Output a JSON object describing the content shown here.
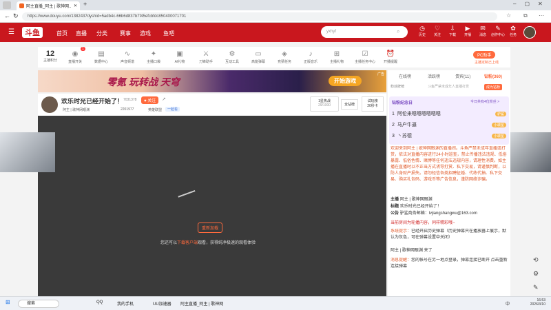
{
  "browser": {
    "tab_title": "阿主直播_阿主 | 歌神网...",
    "url": "https://www.douyu.com/1382437dyshid=5adb4c-66b6d837b7f45efcbfdc850400071701"
  },
  "header": {
    "logo": "斗鱼",
    "nav": [
      "首页",
      "直播",
      "分类",
      "赛事",
      "游戏",
      "鱼吧"
    ],
    "search_placeholder": "yxhyf",
    "icons": [
      {
        "name": "history",
        "label": "历史",
        "glyph": "◷"
      },
      {
        "name": "follow",
        "label": "关注",
        "glyph": "♡"
      },
      {
        "name": "download",
        "label": "下载",
        "glyph": "⇩"
      },
      {
        "name": "broadcast",
        "label": "开播",
        "glyph": "▶"
      },
      {
        "name": "message",
        "label": "消息",
        "glyph": "✉"
      },
      {
        "name": "creator",
        "label": "创作中心",
        "glyph": "✎"
      },
      {
        "name": "task",
        "label": "任务",
        "glyph": "✿"
      }
    ]
  },
  "toolbar": {
    "score_value": "12",
    "score_label": "主播积分",
    "badge_count": "1",
    "items": [
      {
        "name": "live-switch",
        "label": "直播开关",
        "glyph": "◉"
      },
      {
        "name": "data",
        "label": "数据中心",
        "glyph": "▤"
      },
      {
        "name": "voice",
        "label": "声音频谱",
        "glyph": "∿"
      },
      {
        "name": "mouth",
        "label": "主播口袋",
        "glyph": "✦"
      },
      {
        "name": "ai",
        "label": "AI礼物",
        "glyph": "▣"
      },
      {
        "name": "bladefight",
        "label": "刀锋助手",
        "glyph": "⚔"
      },
      {
        "name": "tools",
        "label": "互动工具",
        "glyph": "⚙"
      },
      {
        "name": "barrage",
        "label": "高能弹幕",
        "glyph": "▭"
      },
      {
        "name": "guess",
        "label": "竞猜任务",
        "glyph": "◈"
      },
      {
        "name": "music",
        "label": "正版音乐",
        "glyph": "♪"
      },
      {
        "name": "gift",
        "label": "主播礼物",
        "glyph": "⊞"
      },
      {
        "name": "task",
        "label": "主播任务中心",
        "glyph": "☑"
      },
      {
        "name": "alarm",
        "label": "开播提醒",
        "glyph": "⏰"
      }
    ],
    "pc_label": "PC助手",
    "pc_link": "主播定制己上线"
  },
  "banner": {
    "title_left": "零氪 玩转战 天穹",
    "cta": "开始游戏",
    "ad": "广告"
  },
  "room": {
    "title": "欢乐时光已经开始了！",
    "id": "7031378",
    "follow": "关注",
    "streamer": "阿主 | 歌神网眼渊",
    "fans": "2201977",
    "category": "英雄联盟",
    "tag": "一起看",
    "rank_label": "1星热战",
    "rank_value": "29/1000",
    "fans_btn": "全站榜",
    "tryout": "试玩榜",
    "tryout_sub": "20秒卡"
  },
  "player": {
    "reload": "重新加载",
    "tip_prefix": "您还可以",
    "tip_link": "下载客户端",
    "tip_suffix": "观看，获得纯净极速的观看体验"
  },
  "side": {
    "tabs": [
      "在线榜",
      "活跃榜",
      "贵宾(11)",
      "钻粉(360)"
    ],
    "promo": "粉丝牌榜",
    "promo_sub": "斗鱼严禁未成年人直播打赏",
    "promo_btn": "成为钻粉",
    "diamond_title": "钻粉纪念日",
    "diamond_time": "今日共有4位粉丝 >",
    "fans": [
      {
        "rank": "1",
        "name": "阿伦来嗯嗯嗯嗯嗯嗯",
        "badge": "驴鲨"
      },
      {
        "rank": "2",
        "name": "马户牛逼",
        "badge": "小歌星"
      },
      {
        "rank": "3",
        "name": "丶苏德",
        "badge": "小歌星"
      }
    ],
    "welcome": "欢迎来到阿主 | 歌神网眼渊的直播间。斗鱼严禁未成年直播或打赏，依法对直播内容进行24小时巡查，禁止传播违法违规、低俗暴露、低俗色情、赌博等任何违法违规内容，请理性消费。如主播在直播时以不正当方式诱导打赏、私下交易，请谨慎判断，以防人身财产损失。请勿轻信各类招聘征婚、代练代抽、私下交易、购买礼包码、游戏币等广告信息，谨防网络诈骗。",
    "info": [
      {
        "k": "主播",
        "v": "阿主 | 歌神网眼渊"
      },
      {
        "k": "标题",
        "v": "欢乐时光已经开始了！"
      },
      {
        "k": "公告",
        "v": "驴鲨商务邮箱：lvjiangshangwu@163.com"
      }
    ],
    "notice1": "当前房间为轮播内容，同样精彩哦~",
    "notice2_label": "系统提示：",
    "notice2": "已经开启历史弹幕（历史弹幕只在播放器上展示，默认为灰色，可在弹幕设置中关闭）",
    "notice3": "阿主 | 歌神网眼渊 来了",
    "notice4_label": "消息提醒：",
    "notice4": "您的帐号在另一地点登录，弹幕连接已断开 点击重新连接弹幕"
  },
  "taskbar": {
    "search": "搜索",
    "apps": [
      "QQ",
      "我的手机",
      "UU加速器",
      "阿主直播_阿主 | 歌神网"
    ],
    "time": "16:53",
    "date": "2026/3/10",
    "lang": "中"
  }
}
